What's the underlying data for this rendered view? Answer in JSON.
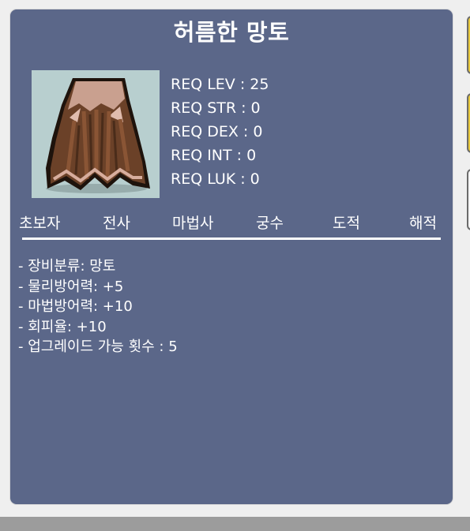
{
  "item": {
    "name": "허름한 망토",
    "image_icon": "brown-cape-icon",
    "requirements": [
      "REQ LEV : 25",
      "REQ STR : 0",
      "REQ DEX : 0",
      "REQ INT : 0",
      "REQ LUK : 0"
    ],
    "jobs": [
      "초보자",
      "전사",
      "마법사",
      "궁수",
      "도적",
      "해적"
    ],
    "properties": [
      "- 장비분류: 망토",
      "- 물리방어력: +5",
      "- 마법방어력: +10",
      "- 회피율: +10",
      "- 업그레이드 가능 횟수 : 5"
    ]
  },
  "colors": {
    "panel_bg": "#5b6789",
    "text": "#ffffff",
    "image_bg": "#b8cfcf",
    "side_tab_accent": "#e9c93a"
  }
}
